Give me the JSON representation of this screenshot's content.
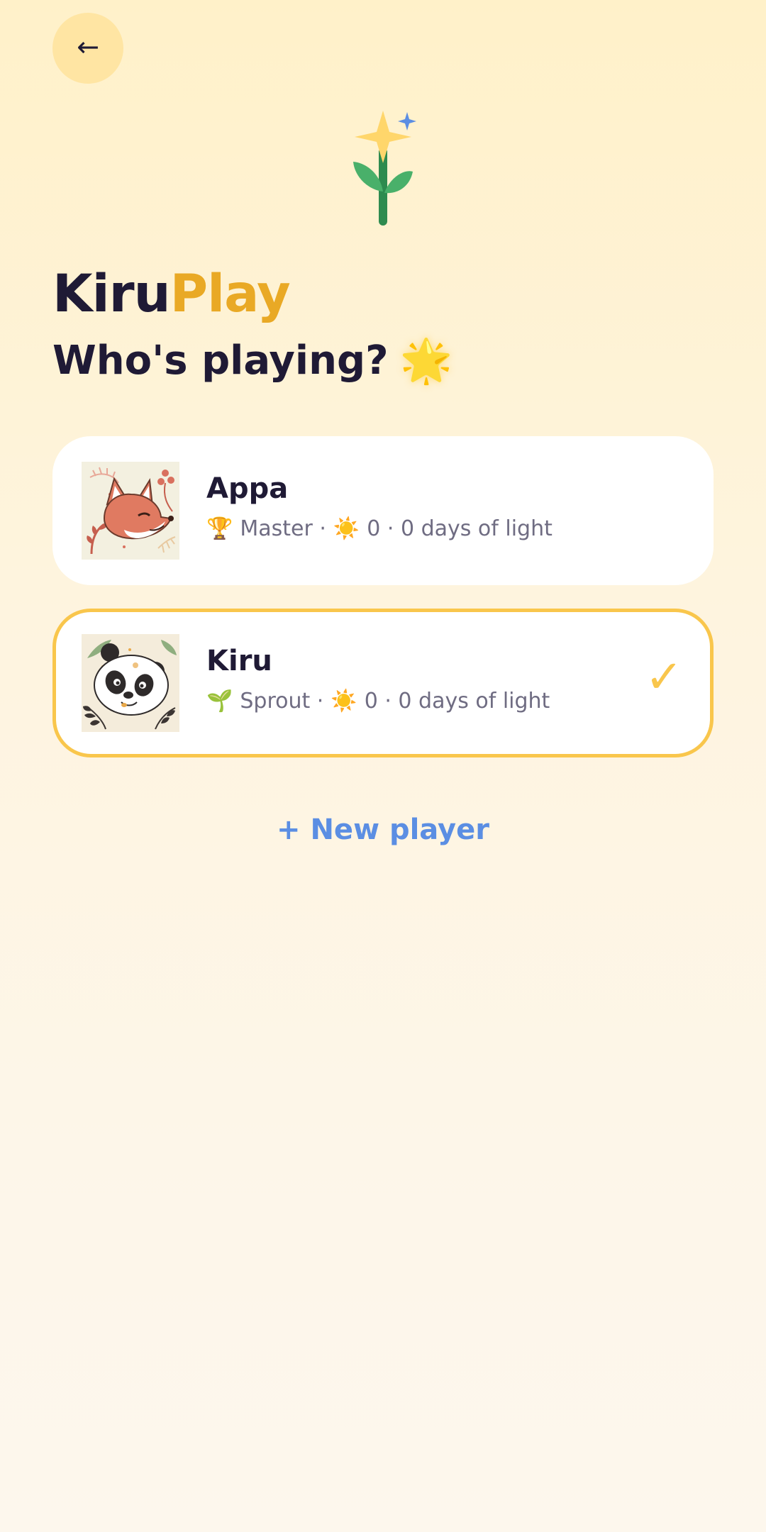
{
  "header": {
    "back_icon": "arrow-left-icon",
    "back_glyph": "←"
  },
  "logo": {
    "icon": "star-flower-icon",
    "colors": {
      "star": "#ffd66b",
      "sparkle": "#5b8ee3",
      "stem": "#2e8b4f",
      "leaf": "#49b06a"
    }
  },
  "title": {
    "part_a": "Kiru",
    "part_b": "Play"
  },
  "subtitle": {
    "text": "Who's playing?",
    "emoji": "🌟"
  },
  "players": [
    {
      "name": "Appa",
      "avatar": "fox-avatar-icon",
      "rank_icon": "trophy-icon",
      "rank_glyph": "🏆",
      "rank": "Master",
      "sun_icon": "sun-icon",
      "sun_glyph": "☀️",
      "suns": "0",
      "days": "0 days of light",
      "selected": false
    },
    {
      "name": "Kiru",
      "avatar": "panda-avatar-icon",
      "rank_icon": "sprout-icon",
      "rank_glyph": "🌱",
      "rank": "Sprout",
      "sun_icon": "sun-icon",
      "sun_glyph": "☀️",
      "suns": "0",
      "days": "0 days of light",
      "selected": true,
      "check_glyph": "✓"
    }
  ],
  "new_player": {
    "label": "+ New player"
  },
  "colors": {
    "accent_yellow": "#f9c64c",
    "brand_gold": "#e9a925",
    "link_blue": "#5b8ee3",
    "dark_text": "#1f1a35",
    "muted_text": "#6f6c82",
    "back_button_bg": "#ffe5a3"
  }
}
